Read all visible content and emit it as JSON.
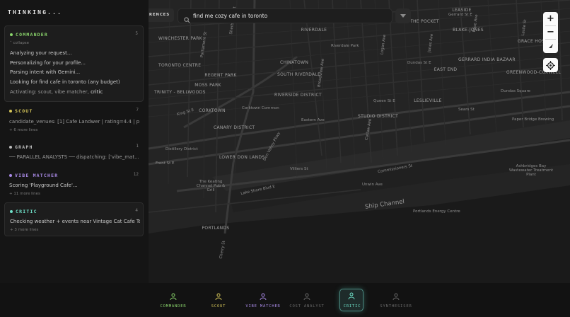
{
  "panel": {
    "title": "THINKING...",
    "cards": [
      {
        "name": "COMMANDER",
        "color": "#8bd66c",
        "count": "5",
        "collapse_label": "collapse",
        "lines": [
          "Analyzing your request...",
          "Personalizing for your profile...",
          "Parsing intent with Gemini...",
          "Looking for find cafe in toronto (any budget)"
        ],
        "activating_prefix": "Activating:",
        "activating_agents": "scout, vibe matcher,",
        "activating_last": "critic"
      },
      {
        "name": "SCOUT",
        "color": "#d8c85a",
        "count": "7",
        "line": "candidate_venues: [1] Cafe Landwer | rating=4.4 | pri...",
        "more": "+ 6 more lines"
      },
      {
        "name": "GRAPH",
        "color": "#bdbdbd",
        "count": "1",
        "line": "── PARALLEL ANALYSTS ── dispatching: ['vibe_mat..."
      },
      {
        "name": "VIBE MATCHER",
        "color": "#a98ae6",
        "count": "12",
        "line": "Scoring 'Playground Cafe'...",
        "more": "+ 11 more lines"
      },
      {
        "name": "CRITIC",
        "color": "#6fe0c8",
        "count": "4",
        "line": "Checking weather + events near Vintage Cat Cafe Tor...",
        "more": "+ 3 more lines"
      }
    ]
  },
  "search": {
    "preferences_chip": "ERENCES",
    "query": "find me cozy cafe in toronto",
    "search_icon": "search-icon",
    "filter_icon": "chevron-down-icon"
  },
  "map_controls": {
    "zoom_in": "+",
    "zoom_out": "−",
    "compass_icon": "compass-icon",
    "locate_icon": "locate-icon"
  },
  "map_labels": {
    "districts": [
      "WINCHESTER PARK",
      "TRINITY - BELLWOODS",
      "RIVERDALE",
      "SOUTH RIVERDALE",
      "CHINATOWN",
      "TORONTO CENTRE",
      "REGENT PARK",
      "MOSS PARK",
      "CORKTOWN",
      "CANARY DISTRICT",
      "LEASIDE",
      "RIVERSIDE DISTRICT",
      "LESLIEVILLE",
      "LOWER DON LANDS",
      "PORTLANDS",
      "EAST END",
      "GERRARD INDIA BAZAAR",
      "STUDIO DISTRICT",
      "GRACE HOSP",
      "THE POCKET",
      "BLAKE-JONES",
      "GREENWOOD-COXWELL"
    ],
    "streets": [
      "Queen St E",
      "Eastern Ave",
      "Commissioners St",
      "Lake Shore Blvd E",
      "Unwin Ave",
      "Villiers St",
      "Gerrard St E",
      "Dundas St E",
      "Carlaw Ave",
      "King St E",
      "Front St E",
      "Don Valley Pkwy",
      "Cherry St",
      "Carlaw Ave",
      "Broadview Ave",
      "Logan Ave",
      "Jones Ave",
      "Pape Ave",
      "Leslie St",
      "Parliament St",
      "Sherbourne St"
    ],
    "water": "Ship Channel",
    "pois": [
      "Portlands Energy Centre",
      "The Keating Channel Pub & Grill",
      "Distillery District",
      "Ashbridges Bay Wastewater Treatment Plant",
      "Riverdale Park",
      "Sears St",
      "Dundas Square",
      "Corktown Common",
      "Paper Bridge Brewing"
    ]
  },
  "bottom_bar": {
    "agents": [
      {
        "label": "COMMANDER",
        "color": "#8bd66c",
        "icon": "agent-icon",
        "selected": false
      },
      {
        "label": "SCOUT",
        "color": "#d8c85a",
        "icon": "agent-icon",
        "selected": false
      },
      {
        "label": "VIBE MATCHER",
        "color": "#a98ae6",
        "icon": "agent-icon",
        "selected": false
      },
      {
        "label": "COST ANALYST",
        "color": "#6a6a6a",
        "icon": "agent-icon",
        "selected": false
      },
      {
        "label": "CRITIC",
        "color": "#6fe0c8",
        "icon": "agent-icon",
        "selected": true
      },
      {
        "label": "SYNTHESISER",
        "color": "#6a6a6a",
        "icon": "agent-icon",
        "selected": false
      }
    ]
  }
}
